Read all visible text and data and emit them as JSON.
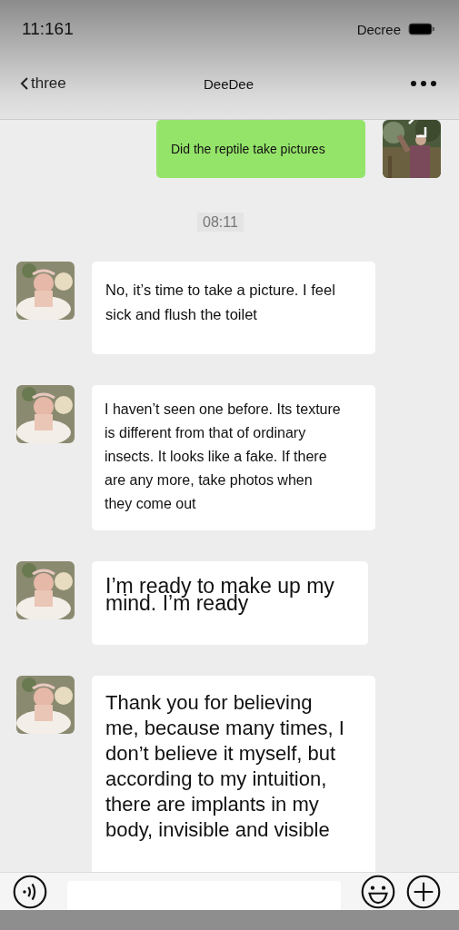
{
  "status_bar": {
    "time": "11:161",
    "carrier": "Decree"
  },
  "nav": {
    "back": "three",
    "title": "DeeDee"
  },
  "messages": [
    {
      "kind": "sent",
      "text": "Did the reptile take pictures"
    },
    {
      "kind": "time",
      "text": "08:11"
    },
    {
      "kind": "received",
      "text": "No, it’s time to take a picture. I feel sick and flush the toilet"
    },
    {
      "kind": "received",
      "text": "I haven’t seen one before. Its texture is different from that of ordinary insects. It looks like a fake. If there are any more, take photos when they come out"
    },
    {
      "kind": "received",
      "text": "I’m ready to make up my mind. I’m ready"
    },
    {
      "kind": "received",
      "text": "Thank you for believing me, because many times, I don’t believe it myself, but according to my intuition, there are implants in my body, invisible and visible"
    }
  ]
}
